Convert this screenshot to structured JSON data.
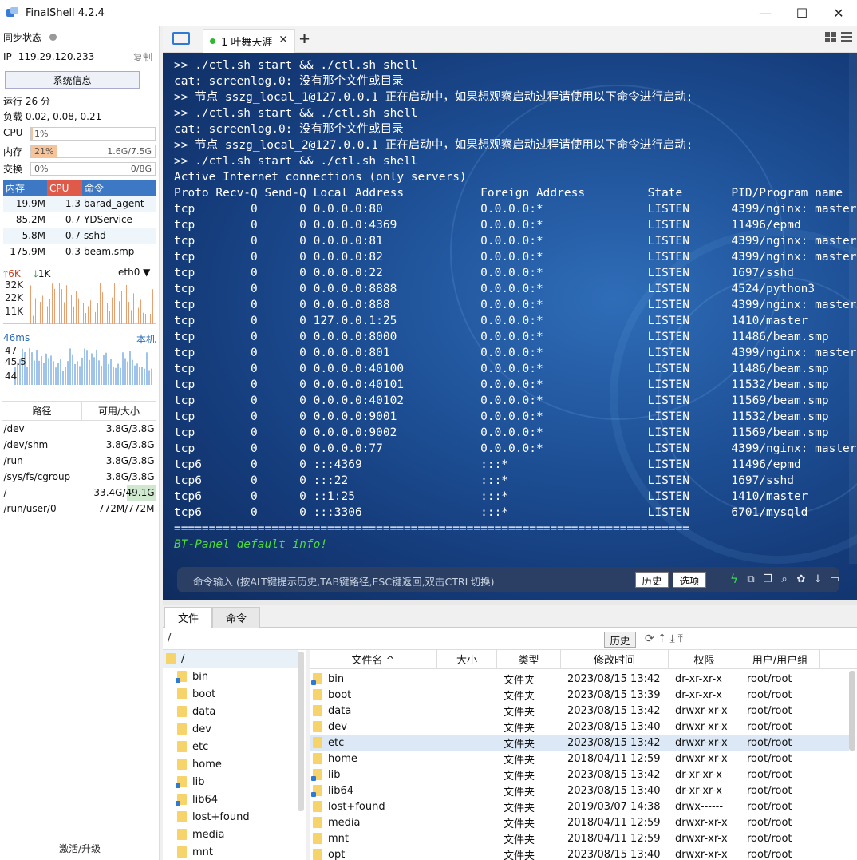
{
  "app": {
    "title": "FinalShell 4.2.4"
  },
  "window": {
    "minimize": "—",
    "maximize": "☐",
    "close": "✕"
  },
  "sidebar": {
    "sync_label": "同步状态",
    "ip_label": "IP",
    "ip_value": "119.29.120.233",
    "copy": "复制",
    "sysinfo": "系统信息",
    "uptime": "运行 26 分",
    "load": "负载 0.02, 0.08, 0.21",
    "cpu": {
      "label": "CPU",
      "pct": "1%",
      "fraction": 0.01
    },
    "mem": {
      "label": "内存",
      "pct": "21%",
      "value": "1.6G/7.5G",
      "fraction": 0.21
    },
    "swap": {
      "label": "交换",
      "pct": "0%",
      "value": "0/8G",
      "fraction": 0.0
    },
    "proc_headers": [
      "内存",
      "CPU",
      "命令"
    ],
    "procs": [
      {
        "mem": "19.9M",
        "cpu": "1.3",
        "cmd": "barad_agent"
      },
      {
        "mem": "85.2M",
        "cpu": "0.7",
        "cmd": "YDService"
      },
      {
        "mem": "5.8M",
        "cpu": "0.7",
        "cmd": "sshd"
      },
      {
        "mem": "175.9M",
        "cpu": "0.3",
        "cmd": "beam.smp"
      }
    ],
    "net": {
      "up": "6K",
      "down": "1K",
      "iface": "eth0",
      "ticks": [
        "32K",
        "22K",
        "11K"
      ]
    },
    "ping": {
      "latency": "46ms",
      "host": "本机",
      "ticks": [
        "47",
        "45.5",
        "44"
      ]
    },
    "disk_headers": [
      "路径",
      "可用/大小"
    ],
    "disks": [
      {
        "path": "/dev",
        "size": "3.8G/3.8G"
      },
      {
        "path": "/dev/shm",
        "size": "3.8G/3.8G"
      },
      {
        "path": "/run",
        "size": "3.8G/3.8G"
      },
      {
        "path": "/sys/fs/cgroup",
        "size": "3.8G/3.8G"
      },
      {
        "path": "/",
        "size": "33.4G/49.1G"
      },
      {
        "path": "/run/user/0",
        "size": "772M/772M"
      }
    ],
    "activate": "激活/升级"
  },
  "tabs": {
    "session_label": "1 叶舞天涯",
    "close": "✕",
    "plus": "+"
  },
  "terminal": {
    "lines": [
      ">> ./ctl.sh start && ./ctl.sh shell",
      "cat: screenlog.0: 没有那个文件或目录",
      ">> 节点 sszg_local_1@127.0.0.1 正在启动中，如果想观察启动过程请使用以下命令进行启动:",
      ">> ./ctl.sh start && ./ctl.sh shell",
      "cat: screenlog.0: 没有那个文件或目录",
      ">> 节点 sszg_local_2@127.0.0.1 正在启动中，如果想观察启动过程请使用以下命令进行启动:",
      ">> ./ctl.sh start && ./ctl.sh shell",
      "Active Internet connections (only servers)",
      "Proto Recv-Q Send-Q Local Address           Foreign Address         State       PID/Program name",
      "tcp        0      0 0.0.0.0:80              0.0.0.0:*               LISTEN      4399/nginx: master",
      "tcp        0      0 0.0.0.0:4369            0.0.0.0:*               LISTEN      11496/epmd",
      "tcp        0      0 0.0.0.0:81              0.0.0.0:*               LISTEN      4399/nginx: master",
      "tcp        0      0 0.0.0.0:82              0.0.0.0:*               LISTEN      4399/nginx: master",
      "tcp        0      0 0.0.0.0:22              0.0.0.0:*               LISTEN      1697/sshd",
      "tcp        0      0 0.0.0.0:8888            0.0.0.0:*               LISTEN      4524/python3",
      "tcp        0      0 0.0.0.0:888             0.0.0.0:*               LISTEN      4399/nginx: master",
      "tcp        0      0 127.0.0.1:25            0.0.0.0:*               LISTEN      1410/master",
      "tcp        0      0 0.0.0.0:8000            0.0.0.0:*               LISTEN      11486/beam.smp",
      "tcp        0      0 0.0.0.0:801             0.0.0.0:*               LISTEN      4399/nginx: master",
      "tcp        0      0 0.0.0.0:40100           0.0.0.0:*               LISTEN      11486/beam.smp",
      "tcp        0      0 0.0.0.0:40101           0.0.0.0:*               LISTEN      11532/beam.smp",
      "tcp        0      0 0.0.0.0:40102           0.0.0.0:*               LISTEN      11569/beam.smp",
      "tcp        0      0 0.0.0.0:9001            0.0.0.0:*               LISTEN      11532/beam.smp",
      "tcp        0      0 0.0.0.0:9002            0.0.0.0:*               LISTEN      11569/beam.smp",
      "tcp        0      0 0.0.0.0:77              0.0.0.0:*               LISTEN      4399/nginx: master",
      "tcp6       0      0 :::4369                 :::*                    LISTEN      11496/epmd",
      "tcp6       0      0 :::22                   :::*                    LISTEN      1697/sshd",
      "tcp6       0      0 ::1:25                  :::*                    LISTEN      1410/master",
      "tcp6       0      0 :::3306                 :::*                    LISTEN      6701/mysqld",
      "==========================================================================",
      "BT-Panel default info!"
    ],
    "cmd_placeholder": "命令输入 (按ALT键提示历史,TAB键路径,ESC键返回,双击CTRL切换)",
    "history_btn": "历史",
    "options_btn": "选项"
  },
  "bottom": {
    "tabs": [
      "文件",
      "命令"
    ],
    "path": "/",
    "history_btn": "历史",
    "tree_root": "/",
    "tree": [
      {
        "name": "bin",
        "link": true
      },
      {
        "name": "boot",
        "link": false
      },
      {
        "name": "data",
        "link": false
      },
      {
        "name": "dev",
        "link": false
      },
      {
        "name": "etc",
        "link": false
      },
      {
        "name": "home",
        "link": false
      },
      {
        "name": "lib",
        "link": true
      },
      {
        "name": "lib64",
        "link": true
      },
      {
        "name": "lost+found",
        "link": false
      },
      {
        "name": "media",
        "link": false
      },
      {
        "name": "mnt",
        "link": false
      }
    ],
    "file_headers": [
      "文件名 ^",
      "大小",
      "类型",
      "修改时间",
      "权限",
      "用户/用户组"
    ],
    "files": [
      {
        "name": "bin",
        "size": "",
        "type": "文件夹",
        "mtime": "2023/08/15 13:42",
        "perm": "dr-xr-xr-x",
        "owner": "root/root",
        "link": true
      },
      {
        "name": "boot",
        "size": "",
        "type": "文件夹",
        "mtime": "2023/08/15 13:39",
        "perm": "dr-xr-xr-x",
        "owner": "root/root",
        "link": false
      },
      {
        "name": "data",
        "size": "",
        "type": "文件夹",
        "mtime": "2023/08/15 13:42",
        "perm": "drwxr-xr-x",
        "owner": "root/root",
        "link": false
      },
      {
        "name": "dev",
        "size": "",
        "type": "文件夹",
        "mtime": "2023/08/15 13:40",
        "perm": "drwxr-xr-x",
        "owner": "root/root",
        "link": false
      },
      {
        "name": "etc",
        "size": "",
        "type": "文件夹",
        "mtime": "2023/08/15 13:42",
        "perm": "drwxr-xr-x",
        "owner": "root/root",
        "link": false
      },
      {
        "name": "home",
        "size": "",
        "type": "文件夹",
        "mtime": "2018/04/11 12:59",
        "perm": "drwxr-xr-x",
        "owner": "root/root",
        "link": false
      },
      {
        "name": "lib",
        "size": "",
        "type": "文件夹",
        "mtime": "2023/08/15 13:42",
        "perm": "dr-xr-xr-x",
        "owner": "root/root",
        "link": true
      },
      {
        "name": "lib64",
        "size": "",
        "type": "文件夹",
        "mtime": "2023/08/15 13:40",
        "perm": "dr-xr-xr-x",
        "owner": "root/root",
        "link": true
      },
      {
        "name": "lost+found",
        "size": "",
        "type": "文件夹",
        "mtime": "2019/03/07 14:38",
        "perm": "drwx------",
        "owner": "root/root",
        "link": false
      },
      {
        "name": "media",
        "size": "",
        "type": "文件夹",
        "mtime": "2018/04/11 12:59",
        "perm": "drwxr-xr-x",
        "owner": "root/root",
        "link": false
      },
      {
        "name": "mnt",
        "size": "",
        "type": "文件夹",
        "mtime": "2018/04/11 12:59",
        "perm": "drwxr-xr-x",
        "owner": "root/root",
        "link": false
      },
      {
        "name": "opt",
        "size": "",
        "type": "文件夹",
        "mtime": "2023/08/15 13:40",
        "perm": "drwxr-xr-x",
        "owner": "root/root",
        "link": false
      }
    ],
    "selected_file": "etc"
  },
  "colors": {
    "terminal_bg": "#1d4f95",
    "accent": "#3d78c5",
    "cpu_header": "#e05a4a",
    "green_text": "#4ddb3a"
  }
}
